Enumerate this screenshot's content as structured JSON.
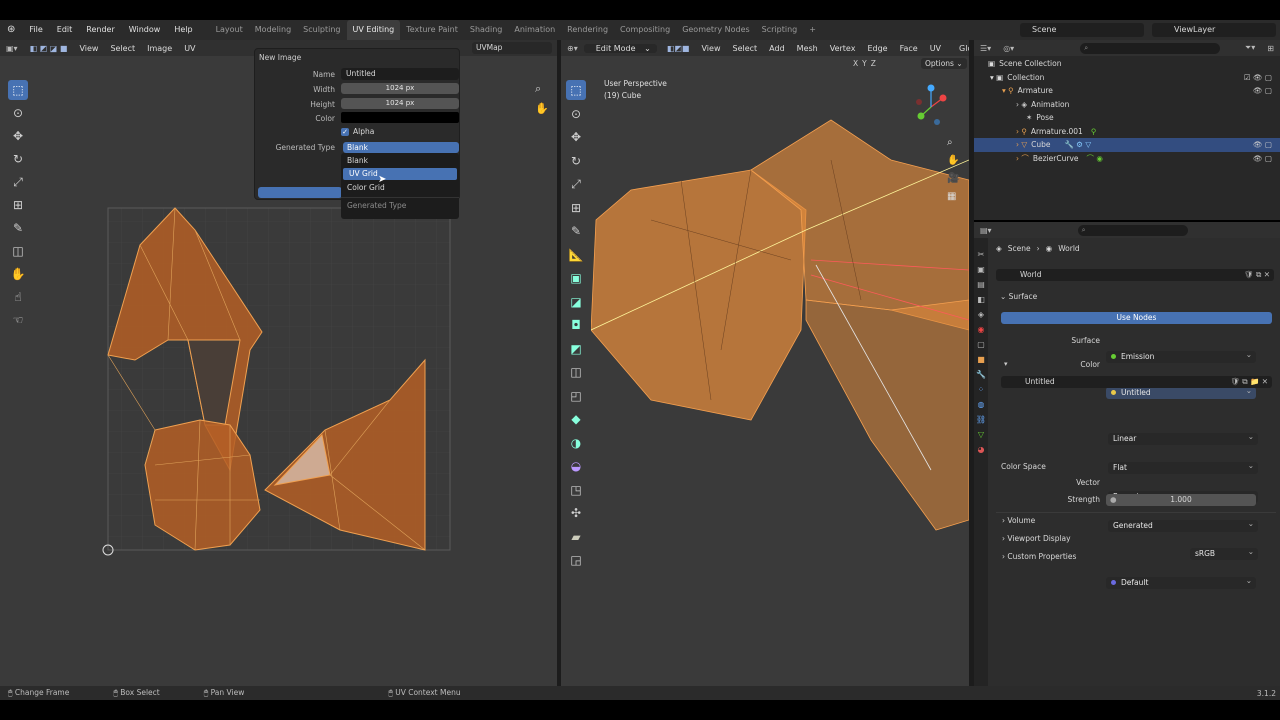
{
  "topbar": {
    "menus": [
      "File",
      "Edit",
      "Render",
      "Window",
      "Help"
    ],
    "workspaces": [
      "Layout",
      "Modeling",
      "Sculpting",
      "UV Editing",
      "Texture Paint",
      "Shading",
      "Animation",
      "Rendering",
      "Compositing",
      "Geometry Nodes",
      "Scripting"
    ],
    "active_workspace": "UV Editing",
    "add_tab": "+",
    "scene": "Scene",
    "view_layer": "ViewLayer"
  },
  "uv_editor": {
    "header_menus": [
      "View",
      "Select",
      "Image",
      "UV"
    ],
    "uvmap": "UVMap"
  },
  "new_image_dialog": {
    "title": "New Image",
    "name_label": "Name",
    "name_value": "Untitled",
    "width_label": "Width",
    "width_value": "1024 px",
    "height_label": "Height",
    "height_value": "1024 px",
    "color_label": "Color",
    "alpha_label": "Alpha",
    "generated_type_label": "Generated Type",
    "generated_type_value": "Blank",
    "dropdown_options": [
      "Blank",
      "UV Grid",
      "Color Grid"
    ],
    "highlighted_option": "UV Grid",
    "dropdown_footer": "Generated Type"
  },
  "viewport": {
    "mode": "Edit Mode",
    "header_menus": [
      "View",
      "Select",
      "Add",
      "Mesh",
      "Vertex",
      "Edge",
      "Face",
      "UV"
    ],
    "glo": "Glo",
    "axes": [
      "X",
      "Y",
      "Z"
    ],
    "options": "Options",
    "perspective": "User Perspective",
    "object_label": "(19) Cube"
  },
  "outliner": {
    "search_placeholder": "",
    "items": [
      {
        "label": "Scene Collection",
        "depth": 0
      },
      {
        "label": "Collection",
        "depth": 1
      },
      {
        "label": "Armature",
        "depth": 2
      },
      {
        "label": "Animation",
        "depth": 3
      },
      {
        "label": "Pose",
        "depth": 3
      },
      {
        "label": "Armature.001",
        "depth": 3
      },
      {
        "label": "Cube",
        "depth": 3,
        "selected": true
      },
      {
        "label": "BezierCurve",
        "depth": 3
      }
    ]
  },
  "properties": {
    "breadcrumb_scene": "Scene",
    "breadcrumb_world": "World",
    "world_name": "World",
    "surface_section": "Surface",
    "use_nodes": "Use Nodes",
    "surface_label": "Surface",
    "surface_value": "Emission",
    "color_label": "Color",
    "color_value": "Untitled",
    "image_name": "Untitled",
    "interpolation": "Linear",
    "projection": "Flat",
    "extension": "Repeat",
    "source": "Generated",
    "color_space_label": "Color Space",
    "color_space_value": "sRGB",
    "vector_label": "Vector",
    "vector_value": "Default",
    "strength_label": "Strength",
    "strength_value": "1.000",
    "sections": [
      "Volume",
      "Viewport Display",
      "Custom Properties"
    ]
  },
  "statusbar": {
    "items": [
      "Change Frame",
      "Box Select",
      "Pan View",
      "UV Context Menu"
    ],
    "version": "3.1.2"
  },
  "colors": {
    "accent": "#4772b3",
    "mesh_orange": "#e08a3c",
    "bg": "#3a3a3a"
  }
}
